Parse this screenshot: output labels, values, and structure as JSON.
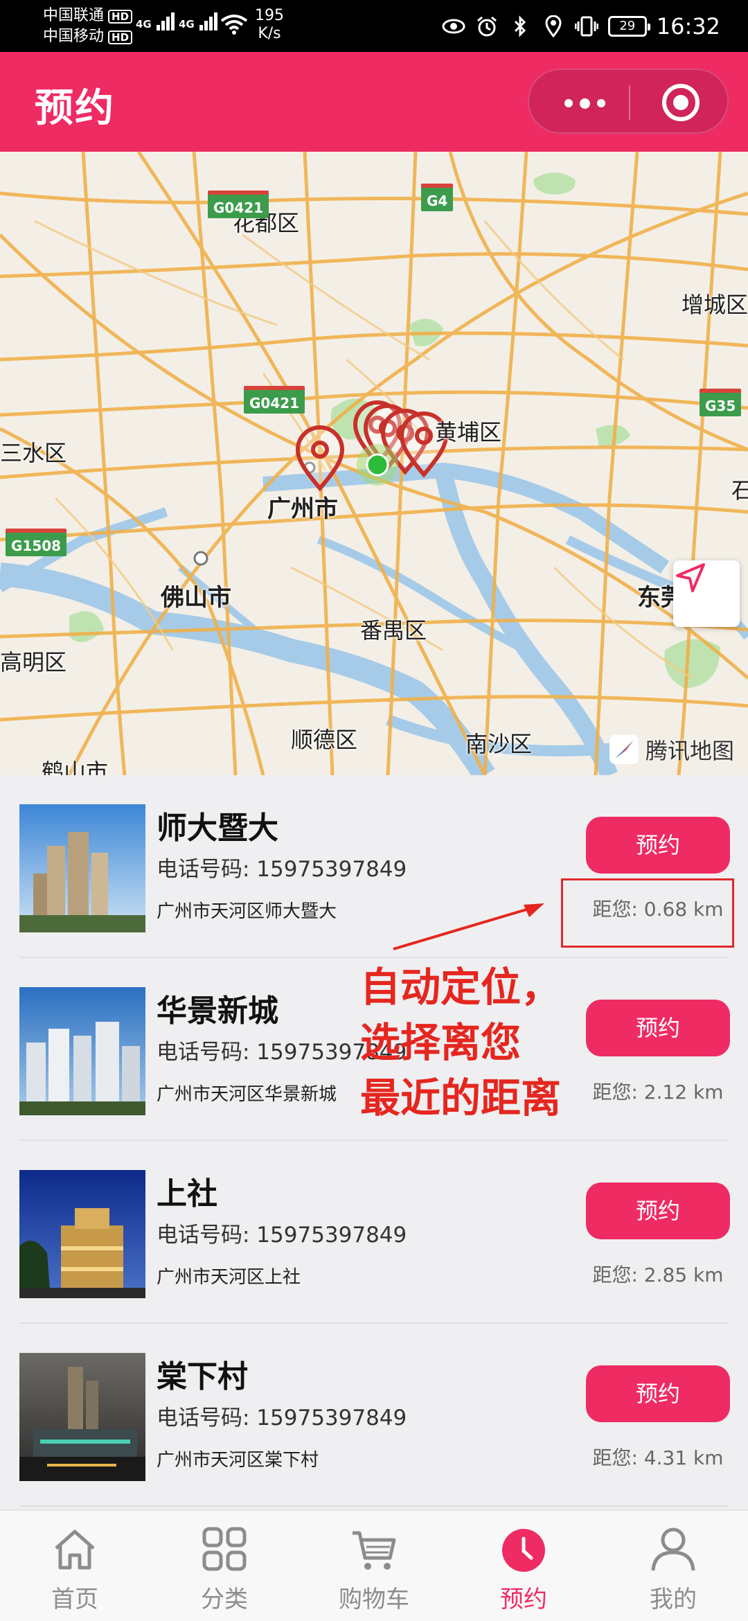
{
  "status_bar": {
    "carrier1": "中国联通",
    "carrier2": "中国移动",
    "hd": "HD",
    "net1": "4G",
    "net2": "4G",
    "speed_value": "195",
    "speed_unit": "K/s",
    "battery": "29",
    "time": "16:32"
  },
  "header": {
    "title": "预约"
  },
  "map": {
    "labels": {
      "huadu": "花都区",
      "zengcheng": "增城区",
      "sanshui": "三水区",
      "huangpu": "黄埔区",
      "guangzhou": "广州市",
      "foshan": "佛山市",
      "panyu": "番禺区",
      "dongguan": "东莞",
      "gaoming": "高明区",
      "shunde": "顺德区",
      "nansha": "南沙区",
      "heshan": "鹤山市",
      "shi": "石"
    },
    "shields": {
      "g0421_top": "G0421",
      "g4": "G4",
      "g0421_mid": "G0421",
      "g35": "G35",
      "g1508": "G1508"
    },
    "brand": "腾讯地图"
  },
  "stores": [
    {
      "name": "师大暨大",
      "phone": "电话号码: 15975397849",
      "address": "广州市天河区师大暨大",
      "button": "预约",
      "distance": "距您: 0.68 km"
    },
    {
      "name": "华景新城",
      "phone": "电话号码: 15975397849",
      "address": "广州市天河区华景新城",
      "button": "预约",
      "distance": "距您: 2.12 km"
    },
    {
      "name": "上社",
      "phone": "电话号码: 15975397849",
      "address": "广州市天河区上社",
      "button": "预约",
      "distance": "距您: 2.85 km"
    },
    {
      "name": "棠下村",
      "phone": "电话号码: 15975397849",
      "address": "广州市天河区棠下村",
      "button": "预约",
      "distance": "距您: 4.31 km"
    }
  ],
  "annotation": {
    "line1": "自动定位，",
    "line2": "选择离您",
    "line3": "最近的距离"
  },
  "nav": {
    "home": "首页",
    "category": "分类",
    "cart": "购物车",
    "booking": "预约",
    "mine": "我的"
  },
  "colors": {
    "accent": "#ef2b64",
    "annotation": "#e5261f",
    "status_bar": "#000000"
  }
}
